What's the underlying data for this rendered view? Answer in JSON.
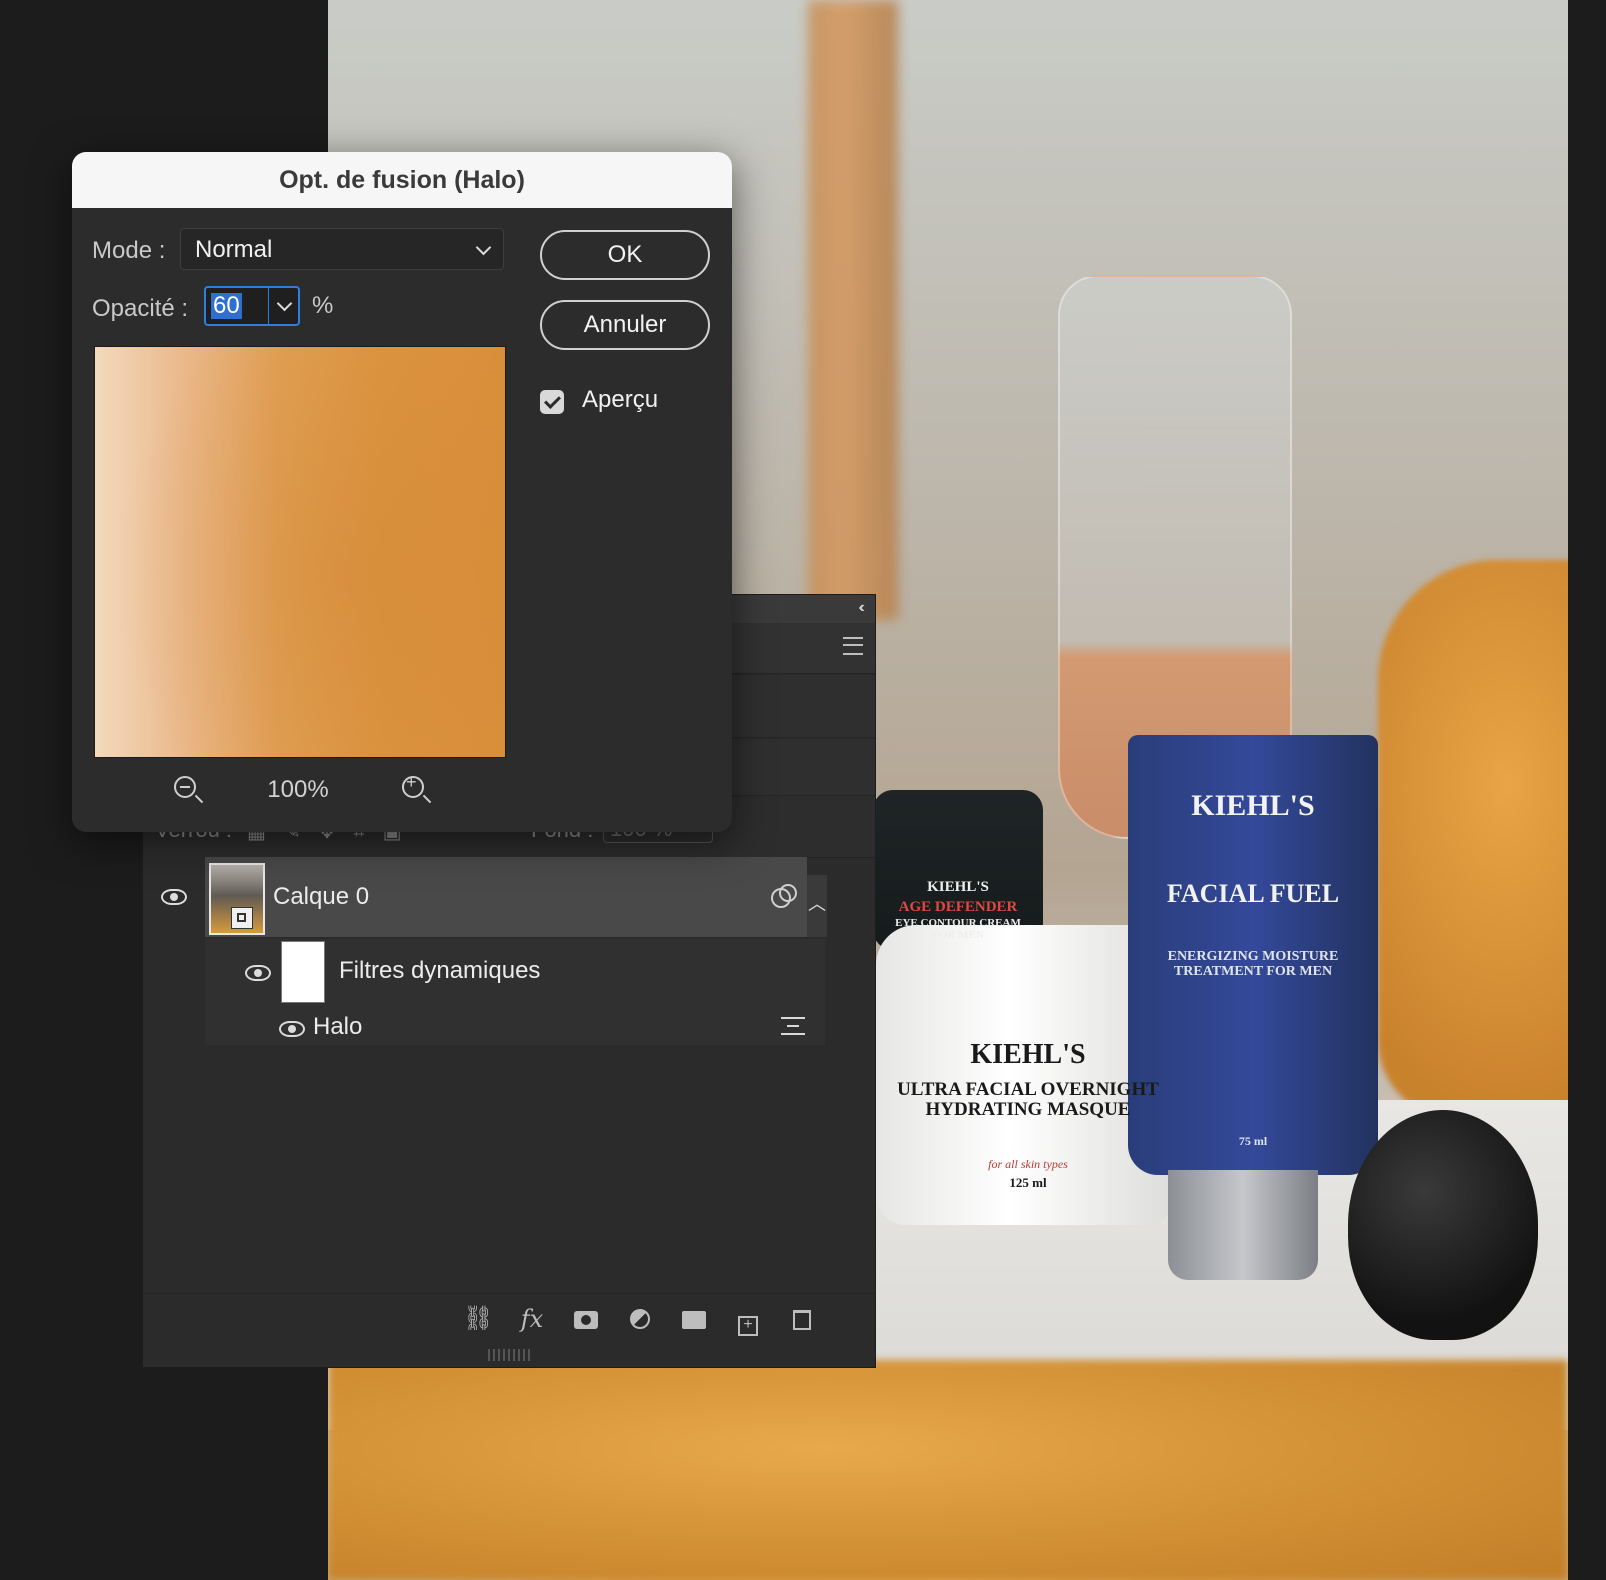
{
  "dialog": {
    "title": "Opt. de fusion (Halo)",
    "mode_label": "Mode :",
    "mode_value": "Normal",
    "opacity_label": "Opacité :",
    "opacity_value": "60",
    "opacity_unit": "%",
    "zoom_level": "100%",
    "ok_label": "OK",
    "cancel_label": "Annuler",
    "preview_label": "Aperçu",
    "preview_checked": true
  },
  "layers_panel": {
    "lock_label": "Verrou :",
    "fill_label": "Fond :",
    "fill_value": "100 %",
    "layers": [
      {
        "name": "Calque 0",
        "visible": true,
        "type": "smart-object"
      },
      {
        "name": "Filtres dynamiques",
        "visible": true,
        "type": "smart-filters"
      },
      {
        "name": "Halo",
        "visible": true,
        "type": "filter"
      }
    ],
    "footer_icons": [
      "link-icon",
      "fx-icon",
      "mask-icon",
      "adjustment-icon",
      "folder-icon",
      "new-layer-icon",
      "trash-icon"
    ]
  },
  "canvas": {
    "product_labels": {
      "tube_brand": "KIEHL'S",
      "tube_name": "FACIAL FUEL",
      "tube_desc": "ENERGIZING MOISTURE TREATMENT FOR MEN",
      "tube_size": "75 ml",
      "small_jar_brand": "KIEHL'S",
      "small_jar_name": "AGE DEFENDER",
      "small_jar_desc": "EYE CONTOUR CREAM FOR MEN",
      "white_jar_brand": "KIEHL'S",
      "white_jar_name": "ULTRA FACIAL OVERNIGHT HYDRATING MASQUE",
      "white_jar_note": "for all skin types",
      "white_jar_size": "125 ml"
    }
  },
  "colors": {
    "accent": "#2f7de1",
    "panel_bg": "#2b2b2b",
    "dialog_bg": "#2c2c2c",
    "selected_layer": "#494949"
  }
}
